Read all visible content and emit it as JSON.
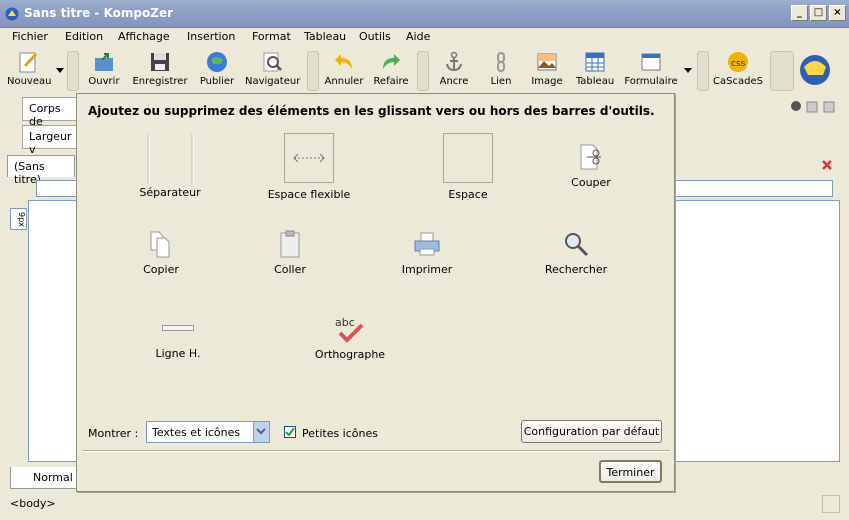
{
  "window": {
    "title": "Sans titre - KompoZer"
  },
  "menu": [
    "Fichier",
    "Edition",
    "Affichage",
    "Insertion",
    "Format",
    "Tableau",
    "Outils",
    "Aide"
  ],
  "toolbar": {
    "new": "Nouveau",
    "open": "Ouvrir",
    "save": "Enregistrer",
    "publish": "Publier",
    "browse": "Navigateur",
    "undo": "Annuler",
    "redo": "Refaire",
    "anchor": "Ancre",
    "link": "Lien",
    "image": "Image",
    "table": "Tableau",
    "form": "Formulaire",
    "cascades": "CaScadeS"
  },
  "format_toolbar": {
    "paragraph_select": "Corps de",
    "width_select": "Largeur v"
  },
  "document": {
    "tab_label": "(Sans titre)",
    "ruler_unit": "9px",
    "mode_tab": "Normal"
  },
  "status": {
    "element_path": "<body>"
  },
  "dialog": {
    "heading": "Ajoutez ou supprimez des éléments en les glissant vers ou hors des barres d'outils.",
    "items": {
      "separator": "Séparateur",
      "flex_space": "Espace flexible",
      "space": "Espace",
      "cut": "Couper",
      "copy": "Copier",
      "paste": "Coller",
      "print": "Imprimer",
      "find": "Rechercher",
      "hline": "Ligne H.",
      "spell": "Orthographe"
    },
    "show_label": "Montrer :",
    "show_value": "Textes et icônes",
    "small_icons_label": "Petites icônes",
    "small_icons_checked": true,
    "restore_default": "Configuration par défaut",
    "done": "Terminer"
  }
}
